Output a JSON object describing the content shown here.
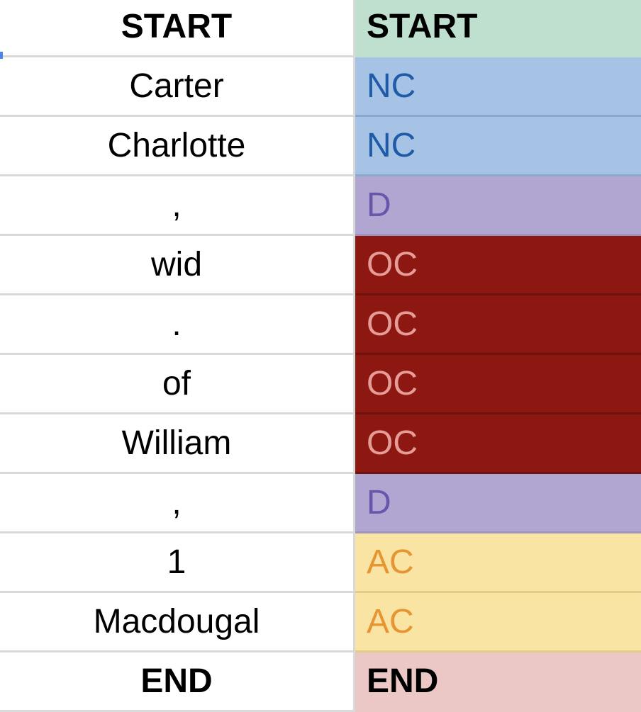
{
  "rows": [
    {
      "token": "START",
      "label": "START",
      "bold": true,
      "bg": "#bfe0cf",
      "fg": "#000000",
      "divider": "#bfe0cf"
    },
    {
      "token": "Carter",
      "label": "NC",
      "bold": false,
      "bg": "#a6c3e6",
      "fg": "#1f5ba6",
      "divider": "#8aa9cf"
    },
    {
      "token": "Charlotte",
      "label": "NC",
      "bold": false,
      "bg": "#a6c3e6",
      "fg": "#1f5ba6",
      "divider": "#8aa9cf"
    },
    {
      "token": ",",
      "label": "D",
      "bold": false,
      "bg": "#b0a6d1",
      "fg": "#6a55ad",
      "divider": "#9e93c4"
    },
    {
      "token": "wid",
      "label": "OC",
      "bold": false,
      "bg": "#8c1811",
      "fg": "#e79d97",
      "divider": "#6f110c"
    },
    {
      "token": ".",
      "label": "OC",
      "bold": false,
      "bg": "#8c1811",
      "fg": "#e79d97",
      "divider": "#6f110c"
    },
    {
      "token": "of",
      "label": "OC",
      "bold": false,
      "bg": "#8c1811",
      "fg": "#e79d97",
      "divider": "#6f110c"
    },
    {
      "token": "William",
      "label": "OC",
      "bold": false,
      "bg": "#8c1811",
      "fg": "#e79d97",
      "divider": "#6f110c"
    },
    {
      "token": ",",
      "label": "D",
      "bold": false,
      "bg": "#b0a6d1",
      "fg": "#6a55ad",
      "divider": "#9e93c4"
    },
    {
      "token": "1",
      "label": "AC",
      "bold": false,
      "bg": "#fae4a3",
      "fg": "#e69533",
      "divider": "#e3cc85"
    },
    {
      "token": "Macdougal",
      "label": "AC",
      "bold": false,
      "bg": "#fae4a3",
      "fg": "#e69533",
      "divider": "#e3cc85"
    },
    {
      "token": "END",
      "label": "END",
      "bold": true,
      "bg": "#ebc8c5",
      "fg": "#000000",
      "divider": "#ebc8c5"
    }
  ]
}
